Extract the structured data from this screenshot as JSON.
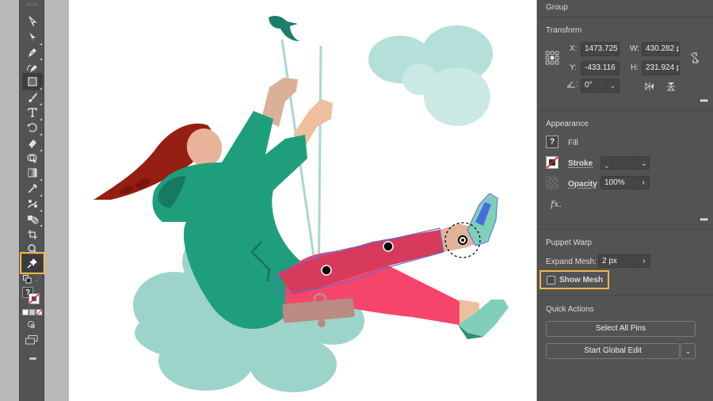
{
  "panel": {
    "group_label": "Group",
    "transform": {
      "title": "Transform",
      "x_label": "X:",
      "x_value": "1473.725",
      "y_label": "Y:",
      "y_value": "-433.116",
      "w_label": "W:",
      "w_value": "430.282 p",
      "h_label": "H:",
      "h_value": "231.924 p",
      "angle_label": ":",
      "angle_value": "0°"
    },
    "appearance": {
      "title": "Appearance",
      "fill_label": "Fill",
      "fill_swatch": "?",
      "stroke_label": "Stroke",
      "stroke_value": "",
      "opacity_label": "Opacity",
      "opacity_value": "100%",
      "fx_label": "fx."
    },
    "puppet_warp": {
      "title": "Puppet Warp",
      "expand_mesh_label": "Expand Mesh:",
      "expand_mesh_value": "2 px",
      "show_mesh_label": "Show Mesh",
      "show_mesh_checked": false
    },
    "quick_actions": {
      "title": "Quick Actions",
      "select_all_pins": "Select All Pins",
      "start_global_edit": "Start Global Edit"
    },
    "more_label": "•••"
  },
  "toolbar": {
    "tools": [
      {
        "name": "selection-tool",
        "icon": "selection-arrow-icon"
      },
      {
        "name": "direct-selection-tool",
        "icon": "direct-selection-icon"
      },
      {
        "name": "pen-tool",
        "icon": "pen-icon"
      },
      {
        "name": "curvature-tool",
        "icon": "curvature-pen-icon"
      },
      {
        "name": "rectangle-tool",
        "icon": "rectangle-icon",
        "active": true
      },
      {
        "name": "paintbrush-tool",
        "icon": "paintbrush-icon"
      },
      {
        "name": "type-tool",
        "icon": "type-icon"
      },
      {
        "name": "rotate-tool",
        "icon": "rotate-icon"
      },
      {
        "name": "eraser-tool",
        "icon": "eraser-icon"
      },
      {
        "name": "shape-builder-tool",
        "icon": "shape-builder-icon"
      },
      {
        "name": "gradient-tool",
        "icon": "gradient-icon"
      },
      {
        "name": "eyedropper-tool",
        "icon": "eyedropper-icon"
      },
      {
        "name": "blend-tool",
        "icon": "blend-icon"
      },
      {
        "name": "symbol-sprayer-tool",
        "icon": "symbol-sprayer-icon"
      },
      {
        "name": "artboard-tool",
        "icon": "artboard-icon"
      },
      {
        "name": "zoom-tool",
        "icon": "zoom-icon"
      },
      {
        "name": "puppet-warp-tool",
        "icon": "pin-icon",
        "highlighted": true
      }
    ],
    "fill_swatch": "?",
    "more_label": "•••"
  },
  "colors": {
    "highlight": "#f0b849",
    "panel_bg": "#535353",
    "hoodie": "#1f9e7c",
    "hoodie_dark": "#177a60",
    "pants": "#f6456a",
    "pants_dark": "#d73a5a",
    "hair": "#951f12",
    "skin": "#e8b39a",
    "cloud": "#9dd4c9",
    "cloud_light": "#c6e6e1",
    "mesh_outline": "#5a6fd6",
    "seat": "#bb8a83",
    "bird": "#1e7d6b",
    "rope": "#a9d8d0"
  }
}
